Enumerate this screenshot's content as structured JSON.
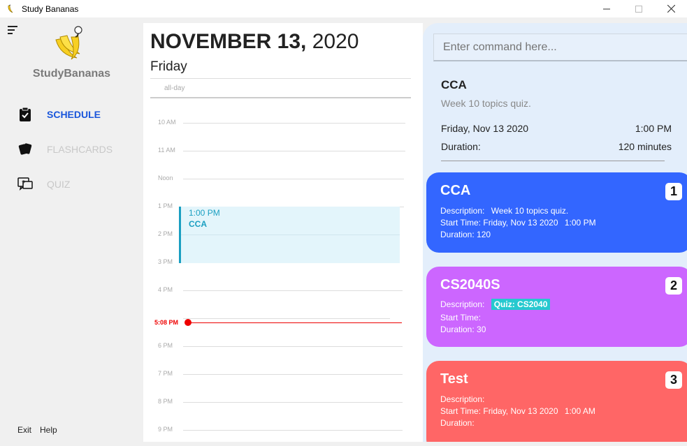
{
  "window": {
    "title": "Study Bananas",
    "controls": [
      "minimize",
      "maximize",
      "close"
    ]
  },
  "sidebar": {
    "brand": "StudyBananas",
    "items": [
      {
        "label": "SCHEDULE",
        "icon": "clipboard-check-icon",
        "active": true
      },
      {
        "label": "FLASHCARDS",
        "icon": "cards-icon",
        "active": false
      },
      {
        "label": "QUIZ",
        "icon": "quiz-chat-icon",
        "active": false
      }
    ],
    "footer": {
      "exit": "Exit",
      "help": "Help"
    }
  },
  "calendar": {
    "date_bold": "NOVEMBER 13,",
    "year": "2020",
    "weekday": "Friday",
    "allday_label": "all-day",
    "hours": [
      "10 AM",
      "11 AM",
      "Noon",
      "1 PM",
      "2 PM",
      "3 PM",
      "4 PM",
      "5:08 PM",
      "6 PM",
      "7 PM",
      "8 PM",
      "9 PM"
    ],
    "event": {
      "time": "1:00 PM",
      "name": "CCA"
    },
    "now_label": "5:08 PM"
  },
  "panel": {
    "command_placeholder": "Enter command here...",
    "detail": {
      "title": "CCA",
      "description": "Week 10 topics quiz.",
      "date": "Friday, Nov 13 2020",
      "time": "1:00 PM",
      "duration_label": "Duration:",
      "duration_value": "120 minutes"
    },
    "cards": [
      {
        "title": "CCA",
        "number": "1",
        "color": "#3366ff",
        "description_label": "Description:",
        "description": "Week 10 topics quiz.",
        "start_label": "Start Time:",
        "start_date": "Friday, Nov 13 2020",
        "start_time": "1:00 PM",
        "duration_label": "Duration:",
        "duration": "120"
      },
      {
        "title": "CS2040S",
        "number": "2",
        "color": "#cc66ff",
        "description_label": "Description:",
        "quiz_tag": "Quiz: CS2040",
        "start_label": "Start Time:",
        "duration_label": "Duration:",
        "duration": "30"
      },
      {
        "title": "Test",
        "number": "3",
        "color": "#ff6666",
        "description_label": "Description:",
        "start_label": "Start Time:",
        "start_date": "Friday, Nov 13 2020",
        "start_time": "1:00 AM",
        "duration_label": "Duration:"
      }
    ]
  }
}
